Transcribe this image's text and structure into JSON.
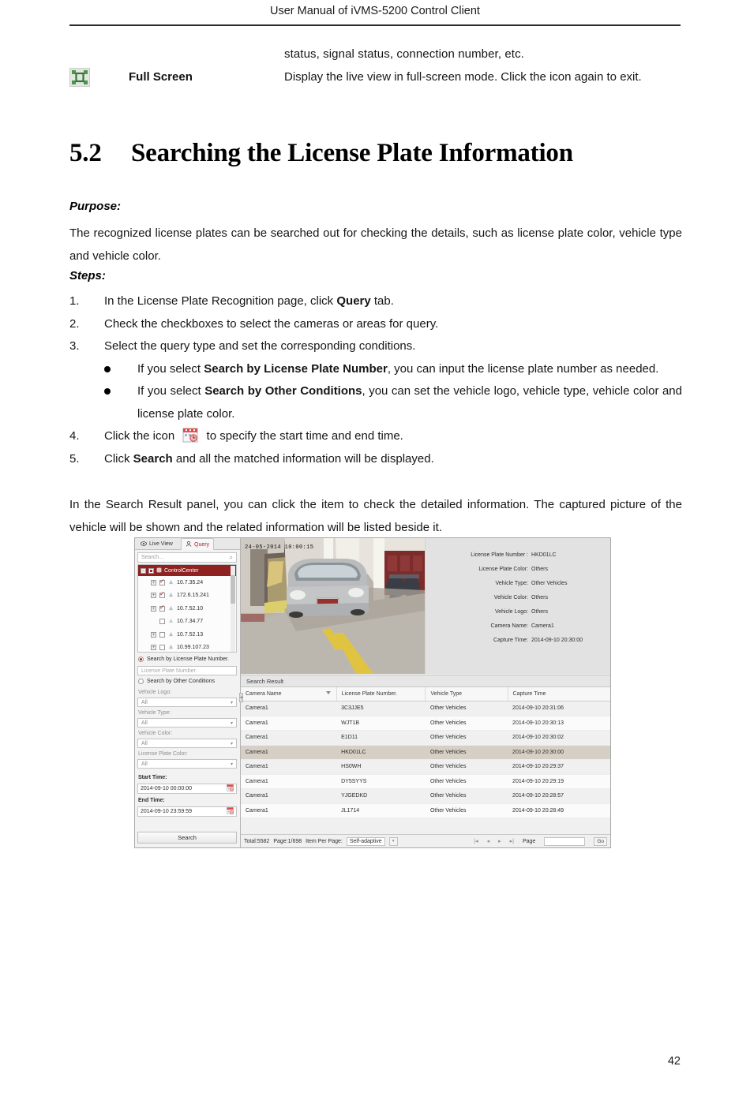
{
  "document": {
    "running_head": "User Manual of iVMS-5200 Control Client",
    "page_number": "42"
  },
  "table_continuation": {
    "wrapped_line": "status, signal status, connection number, etc.",
    "icon_name": "full-screen-icon",
    "feature": "Full Screen",
    "description": "Display the live view in full-screen mode. Click the icon again to exit."
  },
  "section": {
    "number": "5.2",
    "title": "Searching the License Plate Information"
  },
  "purpose": {
    "label": "Purpose:",
    "text": "The recognized license plates can be searched out for checking the details, such as license plate color, vehicle type and vehicle color."
  },
  "steps": {
    "label": "Steps:",
    "items": [
      {
        "num": "1.",
        "text_before": "In the License Plate Recognition page, click ",
        "bold": "Query",
        "text_after": " tab."
      },
      {
        "num": "2.",
        "text_before": "Check the checkboxes to select the cameras or areas for query.",
        "bold": "",
        "text_after": ""
      },
      {
        "num": "3.",
        "text_before": "Select the query type and set the corresponding conditions.",
        "bold": "",
        "text_after": ""
      },
      {
        "num": "4.",
        "text_before": "Click the icon ",
        "bold": "",
        "text_after": " to specify the start time and end time.",
        "icon_name": "calendar-icon"
      },
      {
        "num": "5.",
        "text_before": "Click ",
        "bold": "Search",
        "text_after": " and all the matched information will be displayed."
      }
    ],
    "bullets": [
      {
        "lead": "If you select ",
        "bold": "Search by License Plate Number",
        "tail": ", you can input the license plate number as needed."
      },
      {
        "lead": "If you select ",
        "bold": "Search by Other Conditions",
        "tail": ", you can set the vehicle logo, vehicle type, vehicle color and license plate color."
      }
    ]
  },
  "closing_paragraph": "In the Search Result panel, you can click the item to check the detailed information. The captured picture of the vehicle will be shown and the related information will be listed beside it.",
  "app_screenshot": {
    "tabs": [
      {
        "label": "Live View",
        "icon": "eye-icon",
        "active": false
      },
      {
        "label": "Query",
        "icon": "person-icon",
        "active": true
      }
    ],
    "search_field": {
      "placeholder": "Search...",
      "icon": "magnifier-icon"
    },
    "tree": {
      "root": {
        "label": "ControlCenter",
        "icon": "control-center-icon"
      },
      "nodes": [
        {
          "label": "10.7.35.24",
          "checked": true,
          "expandable": true
        },
        {
          "label": "172.6.15.241",
          "checked": true,
          "expandable": true
        },
        {
          "label": "10.7.52.10",
          "checked": true,
          "expandable": true
        },
        {
          "label": "10.7.34.77",
          "checked": false,
          "expandable": false
        },
        {
          "label": "10.7.52.13",
          "checked": false,
          "expandable": true
        },
        {
          "label": "10.99.107.23",
          "checked": false,
          "expandable": true
        }
      ]
    },
    "query_modes": [
      {
        "label": "Search by License Plate Number.",
        "selected": true
      },
      {
        "label": "Search by Other Conditions",
        "selected": false
      }
    ],
    "plate_input_placeholder": "License Plate Number.",
    "filters": [
      {
        "label": "Vehicle Logo:",
        "value": "All"
      },
      {
        "label": "Vehicle Type:",
        "value": "All"
      },
      {
        "label": "Vehicle Color:",
        "value": "All"
      },
      {
        "label": "License Plate Color:",
        "value": "All"
      }
    ],
    "time_range": {
      "start_label": "Start Time:",
      "start_value": "2014-09-10 00:00:00",
      "end_label": "End Time:",
      "end_value": "2014-09-10 23:59:59",
      "calendar_icon": "calendar-icon"
    },
    "search_button": "Search",
    "video": {
      "timestamp_overlay": "24-05-2014 10:00:15"
    },
    "detail_panel": [
      {
        "key": "License Plate Number :",
        "value": "HKD01LC"
      },
      {
        "key": "License Plate Color:",
        "value": "Others"
      },
      {
        "key": "Vehicle Type:",
        "value": "Other Vehicles"
      },
      {
        "key": "Vehicle Color:",
        "value": "Others"
      },
      {
        "key": "Vehicle Logo:",
        "value": "Others"
      },
      {
        "key": "Camera Name:",
        "value": "Camera1"
      },
      {
        "key": "Capture Time:",
        "value": "2014-09-10 20:30:00"
      }
    ],
    "results": {
      "panel_title": "Search Result",
      "columns": [
        "Camera Name",
        "License Plate Number.",
        "Vehicle Type",
        "Capture Time"
      ],
      "rows": [
        {
          "camera": "Camera1",
          "plate": "3C3JJE5",
          "type": "Other Vehicles",
          "time": "2014-09-10 20:31:06",
          "selected": false
        },
        {
          "camera": "Camera1",
          "plate": "WJT1B",
          "type": "Other Vehicles",
          "time": "2014-09-10 20:30:13",
          "selected": false
        },
        {
          "camera": "Camera1",
          "plate": "E1D11",
          "type": "Other Vehicles",
          "time": "2014-09-10 20:30:02",
          "selected": false
        },
        {
          "camera": "Camera1",
          "plate": "HKD01LC",
          "type": "Other Vehicles",
          "time": "2014-09-10 20:30:00",
          "selected": true
        },
        {
          "camera": "Camera1",
          "plate": "HS0WH",
          "type": "Other Vehicles",
          "time": "2014-09-10 20:29:37",
          "selected": false
        },
        {
          "camera": "Camera1",
          "plate": "DY5SYYS",
          "type": "Other Vehicles",
          "time": "2014-09-10 20:29:19",
          "selected": false
        },
        {
          "camera": "Camera1",
          "plate": "YJGEDKD",
          "type": "Other Vehicles",
          "time": "2014-09-10 20:28:57",
          "selected": false
        },
        {
          "camera": "Camera1",
          "plate": "JL1714",
          "type": "Other Vehicles",
          "time": "2014-09-10 20:28:49",
          "selected": false
        }
      ]
    },
    "pager": {
      "total": "Total:5582",
      "page": "Page:1/698",
      "item_per_page_label": "Item Per Page:",
      "item_per_page_value": "Self-adaptive",
      "nav_first": "|◂",
      "nav_prev": "◂",
      "nav_next": "▸",
      "nav_last": "▸|",
      "page_label": "Page",
      "page_value": "",
      "go_label": "Go"
    }
  },
  "colors": {
    "accent_red": "#b42121",
    "tree_root_bg": "#8f2121",
    "selected_row": "#d6cfc6",
    "full_screen_icon_green": "#3f8a3f"
  }
}
